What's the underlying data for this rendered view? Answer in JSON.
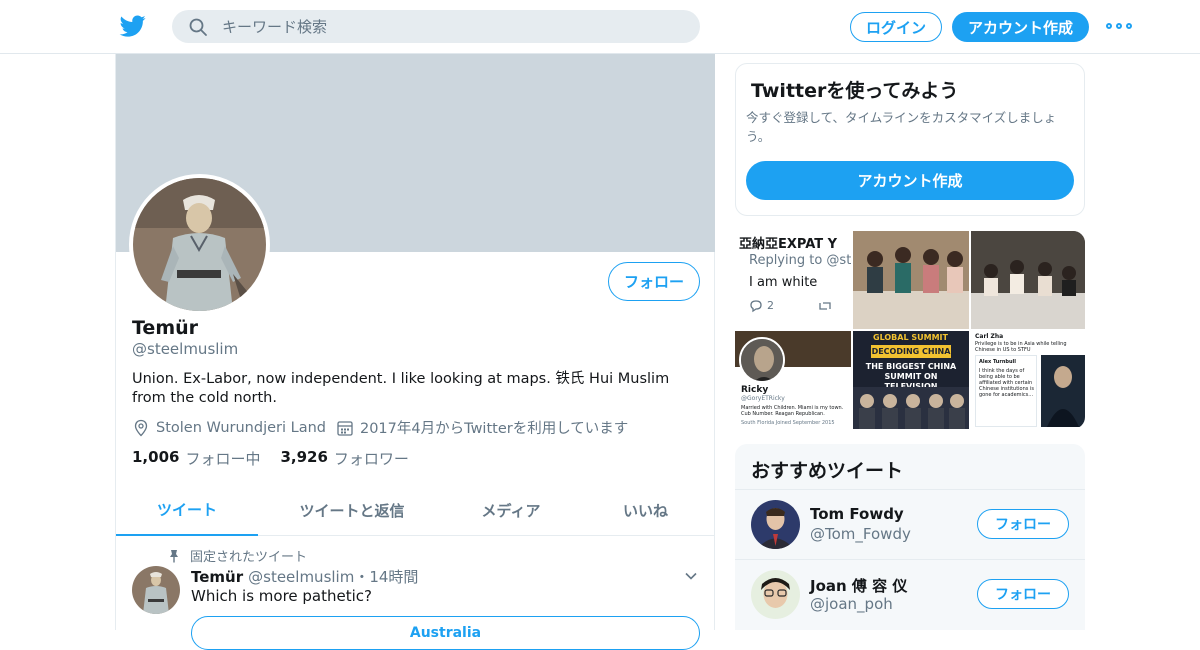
{
  "header": {
    "search_placeholder": "キーワード検索",
    "login_label": "ログイン",
    "signup_label": "アカウント作成",
    "accent_color": "#1da1f2",
    "logo_icon": "twitter-bird-icon"
  },
  "profile": {
    "name": "Temür",
    "handle": "@steelmuslim",
    "follow_label": "フォロー",
    "bio": "Union. Ex-Labor, now independent. I like looking at maps. 铁氏 Hui Muslim from the cold north.",
    "location": "Stolen Wurundjeri Land",
    "joined": "2017年4月からTwitterを利用しています",
    "following_count": "1,006",
    "following_label": "フォロー中",
    "followers_count": "3,926",
    "followers_label": "フォロワー"
  },
  "tabs": [
    {
      "label": "ツイート",
      "active": true
    },
    {
      "label": "ツイートと返信",
      "active": false
    },
    {
      "label": "メディア",
      "active": false
    },
    {
      "label": "いいね",
      "active": false
    }
  ],
  "pinned_tweet": {
    "pinned_label": "固定されたツイート",
    "name": "Temür",
    "handle_time": "@steelmuslim・14時間",
    "text": "Which is more pathetic?",
    "poll_option": "Australia"
  },
  "signup_card": {
    "title": "Twitterを使ってみよう",
    "description": "今すぐ登録して、タイムラインをカスタマイズしましょう。",
    "button": "アカウント作成"
  },
  "media": {
    "tile1_line1": "亞納亞EXPAT Y",
    "tile1_line2": "Replying to @st",
    "tile1_line3": "I am white",
    "tile1_count": "2",
    "tile4_name": "Ricky",
    "tile4_handle": "@GoryETRicky",
    "tile4_bio": "Married with Children. Miami is my town. Cub Number. Reagan Republican.",
    "tile4_meta": "South Florida   Joined September 2015",
    "tile5_top": "GLOBAL SUMMIT",
    "tile5_band": "DECODING CHINA",
    "tile5_caption": "THE BIGGEST CHINA SUMMIT ON TELEVISION",
    "tile6_head": "Carl Zha",
    "tile6_sub": "Privilege is to be in Asia while telling Chinese in US to STFU",
    "tile6_name": "Alex Turnbull",
    "tile6_text": "I think the days of being able to be affiliated with certain Chinese institutions is gone for academics..."
  },
  "suggestions": {
    "title": "おすすめツイート",
    "follow_label": "フォロー",
    "users": [
      {
        "name": "Tom Fowdy",
        "handle": "@Tom_Fowdy"
      },
      {
        "name": "Joan 傅 容 仪",
        "handle": "@joan_poh"
      }
    ]
  }
}
